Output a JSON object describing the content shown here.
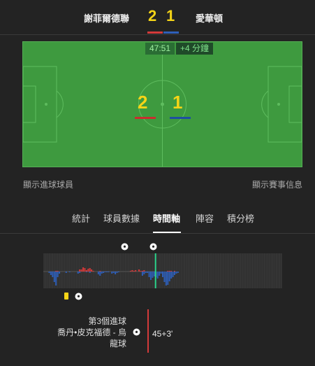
{
  "header": {
    "home_team": "謝菲爾德聯",
    "away_team": "愛華頓",
    "home_score": "2",
    "away_score": "1",
    "home_color": "#d33a3a",
    "away_color": "#2f5fb8"
  },
  "pitch": {
    "clock": "47:51",
    "added_time": "+4 分鐘",
    "home_score": "2",
    "away_score": "1"
  },
  "links": {
    "show_scorers": "顯示進球球員",
    "show_match_info": "顯示賽事信息"
  },
  "tabs": [
    {
      "label": "統計",
      "active": false
    },
    {
      "label": "球員數據",
      "active": false
    },
    {
      "label": "時間軸",
      "active": true
    },
    {
      "label": "陣容",
      "active": false
    },
    {
      "label": "積分榜",
      "active": false
    }
  ],
  "timeline": {
    "home_momentum": [
      0,
      0,
      0,
      0,
      0,
      0,
      0,
      1,
      1,
      0,
      0,
      0,
      0,
      0,
      0,
      0,
      0,
      0,
      0,
      0,
      0,
      3,
      3,
      6,
      5,
      2,
      4,
      5,
      3,
      1,
      0,
      0,
      0,
      1,
      0,
      0,
      0,
      0,
      0,
      0,
      0,
      0,
      0,
      0,
      0,
      0,
      0,
      0,
      0,
      0,
      0,
      1,
      2,
      1,
      2,
      0,
      3,
      1,
      1,
      2,
      0,
      0,
      0,
      0,
      0,
      0,
      0,
      0,
      0,
      0,
      0,
      0,
      0,
      1,
      1,
      1,
      0,
      1,
      0,
      0,
      0,
      0,
      0,
      0,
      0,
      0,
      0,
      0,
      0,
      0,
      0,
      0,
      0,
      0,
      0,
      0,
      0,
      0,
      0,
      0,
      0,
      0,
      0,
      0,
      0,
      0,
      0,
      0,
      0,
      0,
      0,
      0,
      0,
      0,
      0,
      0,
      0,
      0,
      0,
      0,
      0,
      0,
      0,
      0,
      0,
      0,
      0,
      0,
      0,
      0,
      0,
      0,
      0,
      0,
      0,
      0,
      0,
      0,
      0,
      0,
      0
    ],
    "away_momentum": [
      0,
      0,
      0,
      2,
      5,
      8,
      15,
      20,
      8,
      3,
      0,
      0,
      0,
      2,
      0,
      1,
      0,
      0,
      0,
      0,
      3,
      2,
      0,
      0,
      0,
      1,
      0,
      2,
      0,
      0,
      0,
      0,
      4,
      6,
      3,
      2,
      1,
      1,
      1,
      0,
      3,
      2,
      4,
      2,
      1,
      0,
      0,
      0,
      0,
      0,
      0,
      0,
      0,
      0,
      0,
      0,
      0,
      0,
      6,
      4,
      2,
      2,
      8,
      12,
      9,
      7,
      8,
      10,
      6,
      3,
      8,
      15,
      20,
      19,
      14,
      10,
      8,
      5,
      3,
      2,
      0,
      0,
      0,
      0,
      0,
      0,
      0,
      0,
      0,
      0,
      0,
      0,
      0,
      0,
      0,
      0,
      0,
      0,
      0,
      0,
      0,
      0,
      0,
      0,
      0,
      0,
      0,
      0,
      0,
      0,
      0,
      0,
      0,
      0,
      0,
      0,
      0,
      0,
      0,
      0,
      0,
      0,
      0,
      0,
      0,
      0,
      0,
      0,
      0,
      0,
      0,
      0,
      0,
      0,
      0,
      0,
      0,
      0,
      0,
      0,
      0
    ],
    "current_minute_fraction": 0.47
  },
  "event": {
    "title_line1": "第3個進球",
    "title_line2": "喬丹•皮克福德 - 烏",
    "title_line3": "龍球",
    "time": "45+3'"
  }
}
